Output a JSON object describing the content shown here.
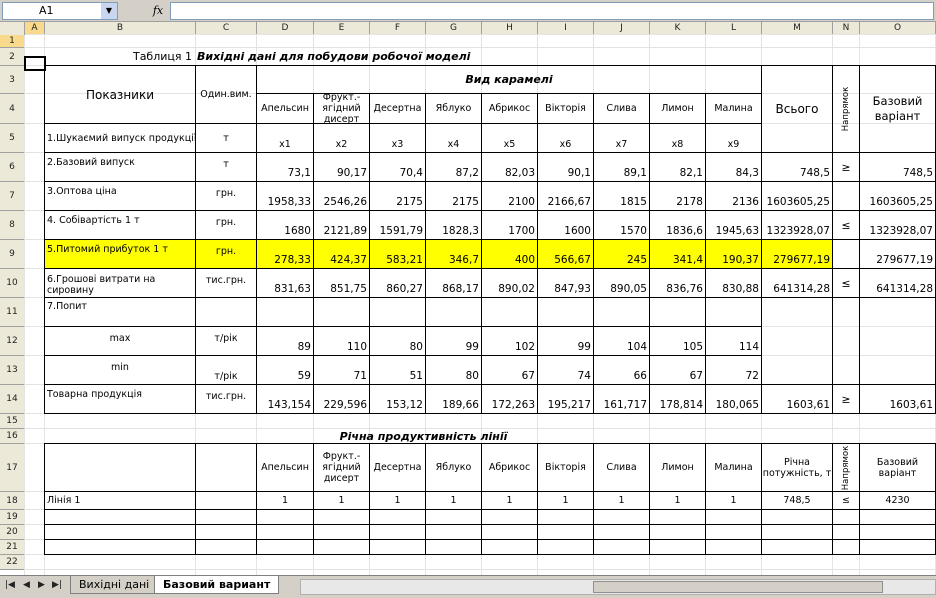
{
  "formula_bar": {
    "cell_ref": "A1",
    "fx": "fx",
    "formula": ""
  },
  "columns": [
    "A",
    "B",
    "C",
    "D",
    "E",
    "F",
    "G",
    "H",
    "I",
    "J",
    "K",
    "L",
    "M",
    "N",
    "O"
  ],
  "selected_column": "A",
  "rows": [
    "1",
    "2",
    "3",
    "4",
    "5",
    "6",
    "7",
    "8",
    "9",
    "10",
    "11",
    "12",
    "13",
    "14",
    "15",
    "16",
    "17",
    "18",
    "19",
    "20",
    "21",
    "22"
  ],
  "selected_row": "1",
  "table1": {
    "caption": "Таблиця 1",
    "title": "Вихідні дані для побудови робочої моделі",
    "h_indicators": "Показники",
    "h_unit": "Один.вим.",
    "h_kind": "Вид карамелі",
    "h_total": "Всього",
    "h_direction": "Напрямок",
    "h_base": "Базовий варіант",
    "products": [
      "Апельсин",
      "Фрукт.-ягідний дисерт",
      "Десертна",
      "Яблуко",
      "Абрикос",
      "Вікторія",
      "Слива",
      "Лимон",
      "Малина"
    ],
    "row5": {
      "label": "1.Шукаємий випуск продукції",
      "unit": "т",
      "vars": [
        "x1",
        "x2",
        "x3",
        "x4",
        "x5",
        "x6",
        "x7",
        "x8",
        "x9"
      ]
    },
    "row6": {
      "label": "2.Базовий випуск",
      "unit": "т",
      "vals": [
        "73,1",
        "90,17",
        "70,4",
        "87,2",
        "82,03",
        "90,1",
        "89,1",
        "82,1",
        "84,3"
      ],
      "total": "748,5",
      "dir": "≥",
      "base": "748,5"
    },
    "row7": {
      "label": "3.Оптова ціна",
      "unit": "грн.",
      "vals": [
        "1958,33",
        "2546,26",
        "2175",
        "2175",
        "2100",
        "2166,67",
        "1815",
        "2178",
        "2136"
      ],
      "total": "1603605,25",
      "dir": "",
      "base": "1603605,25"
    },
    "row8": {
      "label": "4. Собівартість 1 т",
      "unit": "грн.",
      "vals": [
        "1680",
        "2121,89",
        "1591,79",
        "1828,3",
        "1700",
        "1600",
        "1570",
        "1836,6",
        "1945,63"
      ],
      "total": "1323928,07",
      "dir": "≤",
      "base": "1323928,07"
    },
    "row9": {
      "label": "5.Питомий прибуток 1 т",
      "unit": "грн.",
      "vals": [
        "278,33",
        "424,37",
        "583,21",
        "346,7",
        "400",
        "566,67",
        "245",
        "341,4",
        "190,37"
      ],
      "total": "279677,19",
      "dir": "",
      "base": "279677,19"
    },
    "row10": {
      "label": "6.Грошові витрати на сировину",
      "unit": "тис.грн.",
      "vals": [
        "831,63",
        "851,75",
        "860,27",
        "868,17",
        "890,02",
        "847,93",
        "890,05",
        "836,76",
        "830,88"
      ],
      "total": "641314,28",
      "dir": "≤",
      "base": "641314,28"
    },
    "row11": {
      "label": "7.Попит"
    },
    "row12": {
      "label": "max",
      "unit": "т/рік",
      "vals": [
        "89",
        "110",
        "80",
        "99",
        "102",
        "99",
        "104",
        "105",
        "114"
      ]
    },
    "row13": {
      "label": "min",
      "unit": "т/рік",
      "vals": [
        "59",
        "71",
        "51",
        "80",
        "67",
        "74",
        "66",
        "67",
        "72"
      ]
    },
    "row14": {
      "label": "Товарна продукція",
      "unit": "тис.грн.",
      "vals": [
        "143,154",
        "229,596",
        "153,12",
        "189,66",
        "172,263",
        "195,217",
        "161,717",
        "178,814",
        "180,065"
      ],
      "total": "1603,61",
      "dir": "≥",
      "base": "1603,61"
    }
  },
  "table2": {
    "title": "Річна продуктивність лінії",
    "h_capacity": "Річна потужність, т",
    "h_direction": "Напрямок",
    "h_base": "Базовий варіант",
    "row18": {
      "label": "Лінія 1",
      "vals": [
        "1",
        "1",
        "1",
        "1",
        "1",
        "1",
        "1",
        "1",
        "1"
      ],
      "total": "748,5",
      "dir": "≤",
      "base": "4230"
    }
  },
  "sheet_tabs": [
    "Вихідні дані",
    "Базовий вариант"
  ],
  "active_tab": "Базовий вариант",
  "colors": {
    "highlight": "#ffff00",
    "header_bg": "#ece9d8",
    "selected_header": "#f9d98c"
  }
}
